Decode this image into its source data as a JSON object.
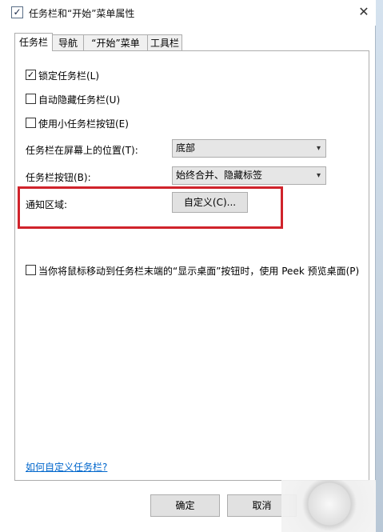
{
  "window": {
    "title": "任务栏和“开始”菜单属性",
    "close_icon": "close-icon",
    "title_icon": "checkbox-icon"
  },
  "tabs": [
    {
      "label": "任务栏",
      "active": true
    },
    {
      "label": "导航",
      "active": false
    },
    {
      "label": "“开始”菜单",
      "active": false
    },
    {
      "label": "工具栏",
      "active": false
    }
  ],
  "options": {
    "lock_taskbar": {
      "label": "锁定任务栏(L)",
      "checked": true
    },
    "auto_hide": {
      "label": "自动隐藏任务栏(U)",
      "checked": false
    },
    "small_buttons": {
      "label": "使用小任务栏按钮(E)",
      "checked": false
    }
  },
  "location": {
    "label": "任务栏在屏幕上的位置(T):",
    "value": "底部"
  },
  "buttons_setting": {
    "label": "任务栏按钮(B):",
    "value": "始终合并、隐藏标签"
  },
  "notification": {
    "label": "通知区域:",
    "button": "自定义(C)..."
  },
  "peek": {
    "label": "当你将鼠标移动到任务栏末端的“显示桌面”按钮时，使用 Peek 预览桌面(P)",
    "checked": false
  },
  "help_link": "如何自定义任务栏?",
  "footer": {
    "ok": "确定",
    "cancel": "取消"
  },
  "colors": {
    "highlight": "#d0232b",
    "link": "#0066cc"
  }
}
